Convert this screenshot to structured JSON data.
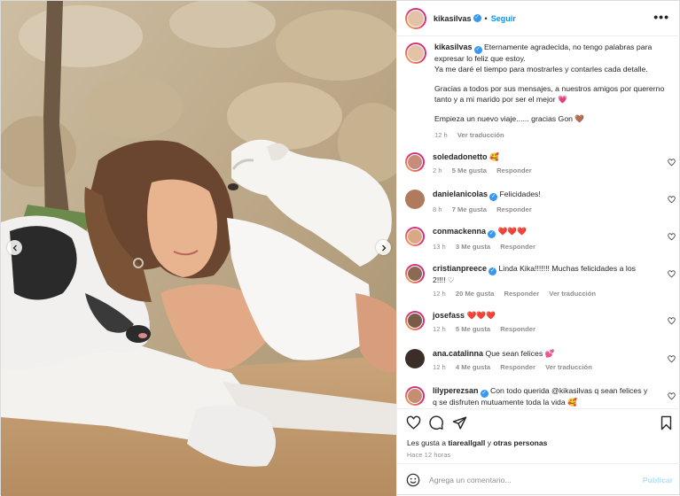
{
  "post": {
    "username": "kikasilvas",
    "verified": true,
    "follow_label": "Seguir",
    "more_label": "•••",
    "caption_lines": [
      "Eternamente agradecida, no tengo palabras para expresar lo feliz que estoy.",
      "Ya me daré el tiempo para mostrarles y contarles cada detalle.",
      "",
      "Gracias a todos por sus mensajes, a nuestros amigos por quererno tanto y a mi marido por ser el mejor 💗",
      "",
      "Empieza un nuevo viaje...... gracias Gon 🤎"
    ],
    "caption_time": "12 h",
    "translate_label": "Ver traducción"
  },
  "comments": [
    {
      "user": "soledadonetto",
      "verified": false,
      "text": "🥰",
      "time": "2 h",
      "likes": "5 Me gusta",
      "reply": "Responder",
      "translate": ""
    },
    {
      "user": "danielanicolas",
      "verified": true,
      "text": "Felicidades!",
      "time": "8 h",
      "likes": "7 Me gusta",
      "reply": "Responder",
      "translate": ""
    },
    {
      "user": "conmackenna",
      "verified": true,
      "text": "❤️❤️❤️",
      "time": "13 h",
      "likes": "3 Me gusta",
      "reply": "Responder",
      "translate": ""
    },
    {
      "user": "cristianpreece",
      "verified": true,
      "text": "Linda Kika!!!!!!! Muchas felicidades a los 2!!!! ♡",
      "time": "12 h",
      "likes": "20 Me gusta",
      "reply": "Responder",
      "translate": "Ver traducción"
    },
    {
      "user": "josefass",
      "verified": false,
      "text": "❤️❤️❤️",
      "time": "12 h",
      "likes": "5 Me gusta",
      "reply": "Responder",
      "translate": ""
    },
    {
      "user": "ana.catalinna",
      "verified": false,
      "text": "Que sean felices 💕",
      "time": "12 h",
      "likes": "4 Me gusta",
      "reply": "Responder",
      "translate": "Ver traducción"
    },
    {
      "user": "lilyperezsan",
      "verified": true,
      "text": "Con todo querida @kikasilvas q sean felices y q se disfruten mutuamente toda la vida 🥰",
      "time": "",
      "likes": "",
      "reply": "",
      "translate": ""
    }
  ],
  "footer": {
    "likes_prefix": "Les gusta a",
    "likes_user": "tiareallgall",
    "likes_join": "y",
    "likes_others": "otras personas",
    "time_ago": "Hace 12 horas",
    "add_comment_placeholder": "Agrega un comentario...",
    "publish_label": "Publicar"
  },
  "icons": {
    "like": "heart-icon",
    "comment": "comment-icon",
    "share": "paper-plane-icon",
    "save": "bookmark-icon",
    "emoji": "smiley-icon",
    "more": "ellipsis-icon",
    "prev": "chevron-left-icon",
    "next": "chevron-right-icon"
  },
  "colors": {
    "link_blue": "#0095f6",
    "muted": "#8e8e8e",
    "text": "#262626",
    "publish_disabled": "#b2dffc",
    "verified": "#3897f0"
  }
}
